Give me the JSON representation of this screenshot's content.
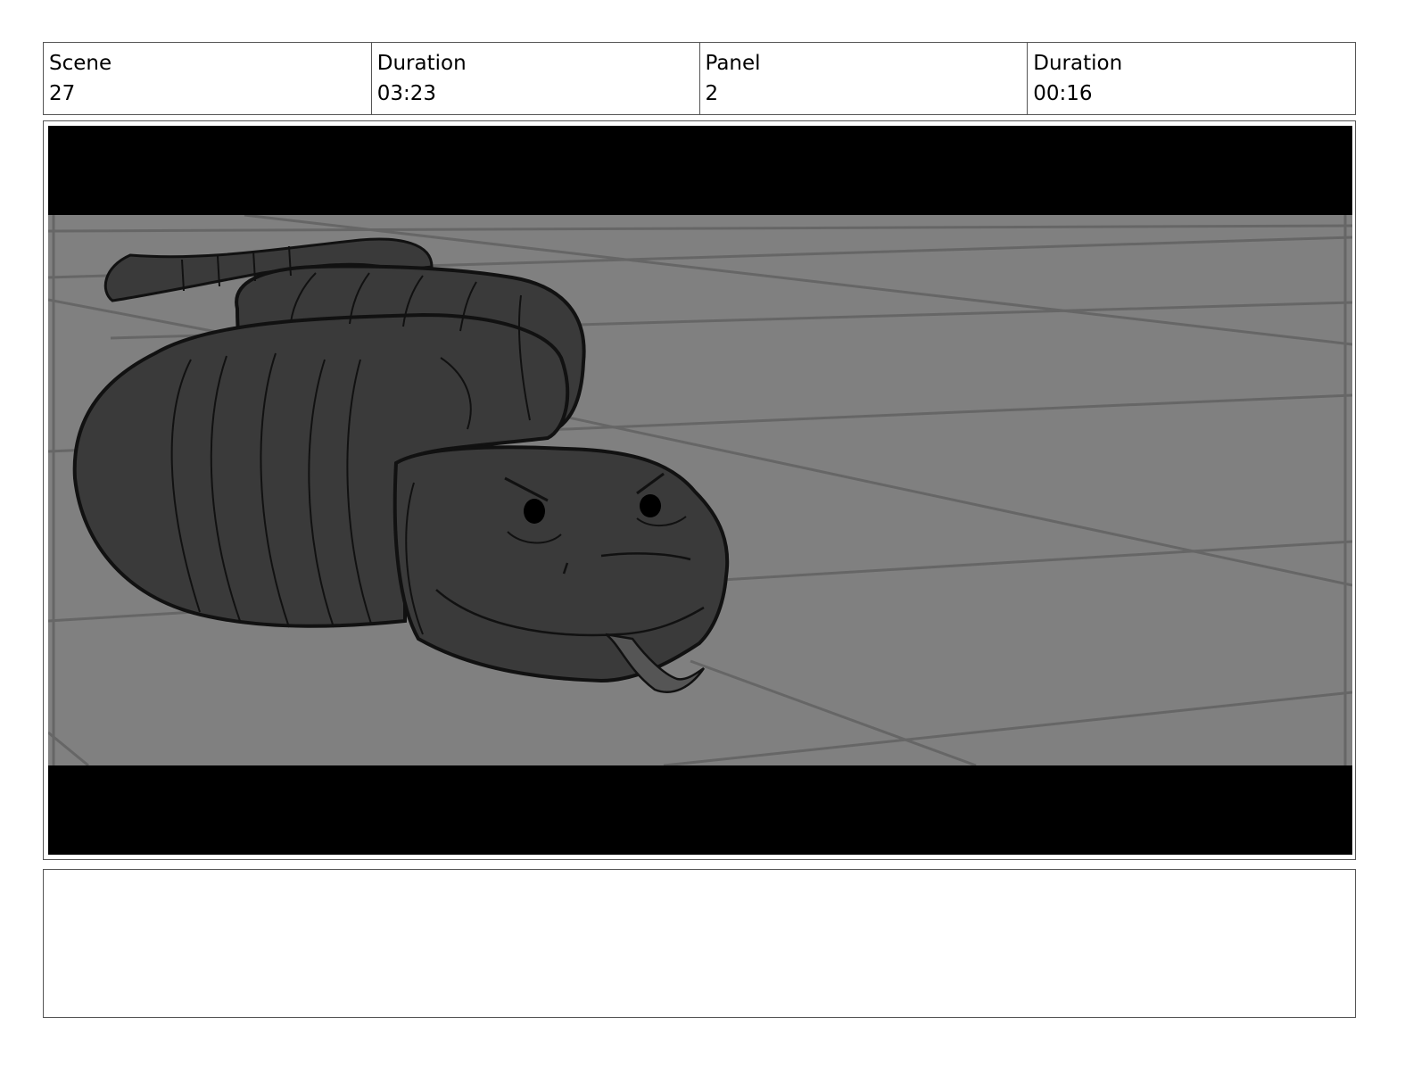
{
  "header": {
    "cells": [
      {
        "label": "Scene",
        "value": "27"
      },
      {
        "label": "Duration",
        "value": "03:23"
      },
      {
        "label": "Panel",
        "value": "2"
      },
      {
        "label": "Duration",
        "value": "00:16"
      }
    ]
  },
  "panel": {
    "subject": "snake-illustration",
    "colors": {
      "letterbox": "#000000",
      "floor": "#808080",
      "floor_lines": "#666666",
      "snake_body": "#3a3a3a",
      "outline": "#111111"
    }
  },
  "notes": {
    "text": ""
  }
}
